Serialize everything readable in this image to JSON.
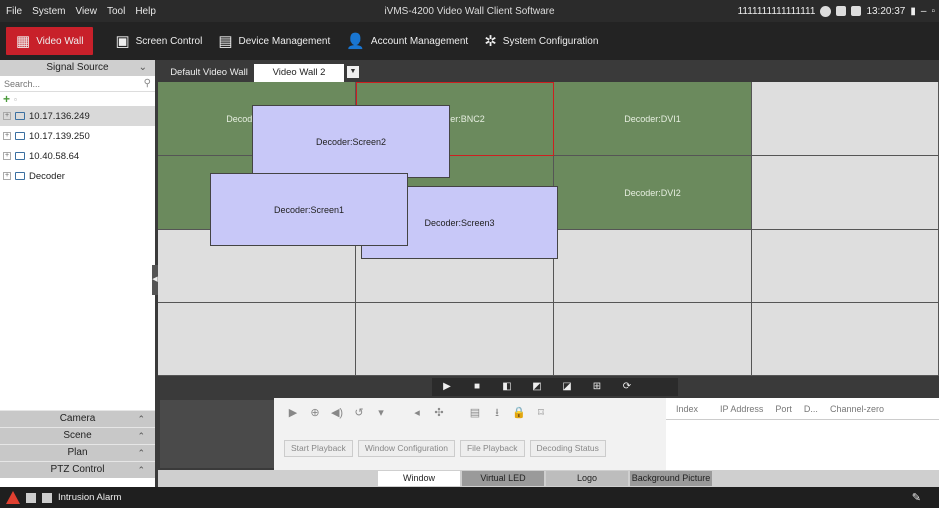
{
  "menubar": {
    "items": [
      "File",
      "System",
      "View",
      "Tool",
      "Help"
    ]
  },
  "window": {
    "title": "iVMS-4200 Video Wall Client Software",
    "user": "1111111111111111",
    "clock": "13:20:37"
  },
  "modules": [
    {
      "label": "Video Wall",
      "icon": "video-wall-icon",
      "glyph": "▦"
    },
    {
      "label": "Screen Control",
      "icon": "screen-control-icon",
      "glyph": "▣"
    },
    {
      "label": "Device Management",
      "icon": "device-management-icon",
      "glyph": "▤"
    },
    {
      "label": "Account Management",
      "icon": "account-icon",
      "glyph": "👤"
    },
    {
      "label": "System Configuration",
      "icon": "gear-icon",
      "glyph": "✲"
    }
  ],
  "left": {
    "header": "Signal Source",
    "search_placeholder": "Search...",
    "tree": [
      "10.17.136.249",
      "10.17.139.250",
      "10.40.58.64",
      "Decoder"
    ],
    "accordion": [
      "Camera",
      "Scene",
      "Plan",
      "PTZ Control"
    ]
  },
  "tabs": {
    "default": "Default Video Wall",
    "active": "Video Wall 2"
  },
  "wall": {
    "cells": [
      "Decoder:BNC1",
      "Decoder:BNC2",
      "Decoder:DVI1",
      "Decoder:DVI2"
    ],
    "windows": [
      "Decoder:Screen2",
      "Decoder:Screen1",
      "Decoder:Screen3"
    ],
    "colors": {
      "decoder": "#6b8a5d",
      "window": "#c8c8f8",
      "selected": "#cc2020",
      "empty": "#dedede"
    }
  },
  "controls": {
    "buttons": [
      "Start Playback",
      "Window Configuration",
      "File Playback",
      "Decoding Status"
    ],
    "device_columns": [
      "Index",
      "IP Address",
      "Port",
      "D...",
      "Channel-zero"
    ]
  },
  "bottom_tabs": [
    "Window",
    "Virtual LED",
    "Logo",
    "Background Picture"
  ],
  "status": {
    "alarm": "Intrusion Alarm"
  }
}
